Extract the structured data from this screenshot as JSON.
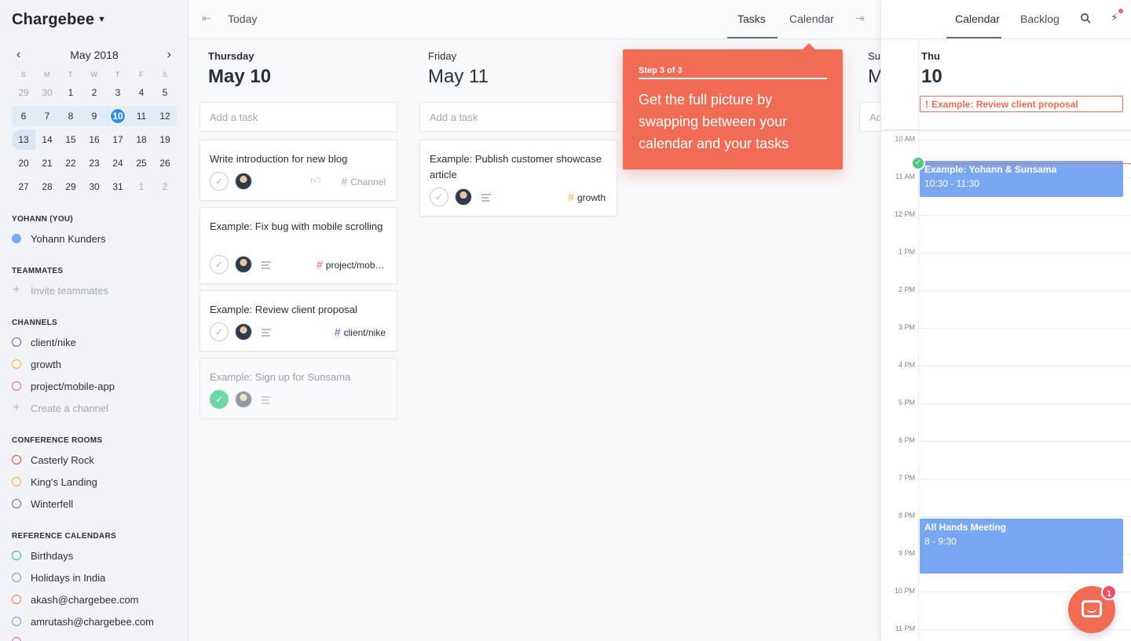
{
  "sidebar": {
    "brand": "Chargebee",
    "calendar": {
      "month": "May 2018",
      "dow": [
        "S",
        "M",
        "T",
        "W",
        "T",
        "F",
        "S"
      ],
      "weeks": [
        [
          "29",
          "30",
          "1",
          "2",
          "3",
          "4",
          "5"
        ],
        [
          "6",
          "7",
          "8",
          "9",
          "10",
          "11",
          "12"
        ],
        [
          "13",
          "14",
          "15",
          "16",
          "17",
          "18",
          "19"
        ],
        [
          "20",
          "21",
          "22",
          "23",
          "24",
          "25",
          "26"
        ],
        [
          "27",
          "28",
          "29",
          "30",
          "31",
          "1",
          "2"
        ]
      ]
    },
    "you_title": "YOHANN (YOU)",
    "you": "Yohann Kunders",
    "teammates_title": "TEAMMATES",
    "invite": "Invite teammates",
    "channels_title": "CHANNELS",
    "channels": [
      {
        "label": "client/nike",
        "color": "#6a5bbf"
      },
      {
        "label": "growth",
        "color": "#f2b33d"
      },
      {
        "label": "project/mobile-app",
        "color": "#ef5b8e"
      }
    ],
    "create_channel": "Create a channel",
    "rooms_title": "CONFERENCE ROOMS",
    "rooms": [
      {
        "label": "Casterly Rock",
        "color": "#e5484d"
      },
      {
        "label": "King's Landing",
        "color": "#f2b33d"
      },
      {
        "label": "Winterfell",
        "color": "#7b5ea7"
      }
    ],
    "refcal_title": "REFERENCE CALENDARS",
    "refcals": [
      {
        "label": "Birthdays",
        "color": "#3cb371"
      },
      {
        "label": "Holidays in India",
        "color": "#6a9be8"
      },
      {
        "label": "akash@chargebee.com",
        "color": "#f07a4a"
      },
      {
        "label": "amrutash@chargebee.com",
        "color": "#6a9be8"
      }
    ],
    "you_color": "#79a7f2"
  },
  "main": {
    "today": "Today",
    "tabs": [
      "Tasks",
      "Calendar"
    ],
    "add_task": "Add a task",
    "days": [
      {
        "name": "Thursday",
        "date": "May 10",
        "cards": [
          {
            "title": "Write introduction for new blog",
            "channel": "Channel",
            "done": false
          },
          {
            "title": "Example: Fix bug with mobile scrolling",
            "channel": "project/mobile-app",
            "done": false
          },
          {
            "title": "Example: Review client proposal",
            "channel": "client/nike",
            "done": false
          },
          {
            "title": "Example: Sign up for Sunsama",
            "channel": "",
            "done": true
          }
        ]
      },
      {
        "name": "Friday",
        "date": "May 11",
        "cards": [
          {
            "title": "Example: Publish customer showcase article",
            "channel": "growth",
            "done": false
          }
        ]
      },
      {
        "name": "Su",
        "date": "M",
        "add_partial": "Ad",
        "cards": []
      }
    ],
    "hash": "#",
    "colors": {
      "project": "#ef5b8e",
      "client": "#6a5bbf",
      "growth": "#f2b33d"
    }
  },
  "tooltip": {
    "step": "Step 3 of 3",
    "message": "Get the full picture by swapping between your calendar and your tasks"
  },
  "right": {
    "tabs": [
      "Calendar",
      "Backlog"
    ],
    "day_name": "Thu",
    "day_num": "10",
    "allday_event": "Example: Review client proposal",
    "hours": [
      "10 AM",
      "11 AM",
      "12 PM",
      "1 PM",
      "2 PM",
      "3 PM",
      "4 PM",
      "5 PM",
      "6 PM",
      "7 PM",
      "8 PM",
      "9 PM",
      "10 PM",
      "11 PM"
    ],
    "events": [
      {
        "title": "Example: Yohann & Sunsama",
        "time": "10:30 - 11:30"
      },
      {
        "title": "All Hands Meeting",
        "time": "8 - 9:30"
      }
    ]
  },
  "chat": {
    "badge": "1"
  }
}
